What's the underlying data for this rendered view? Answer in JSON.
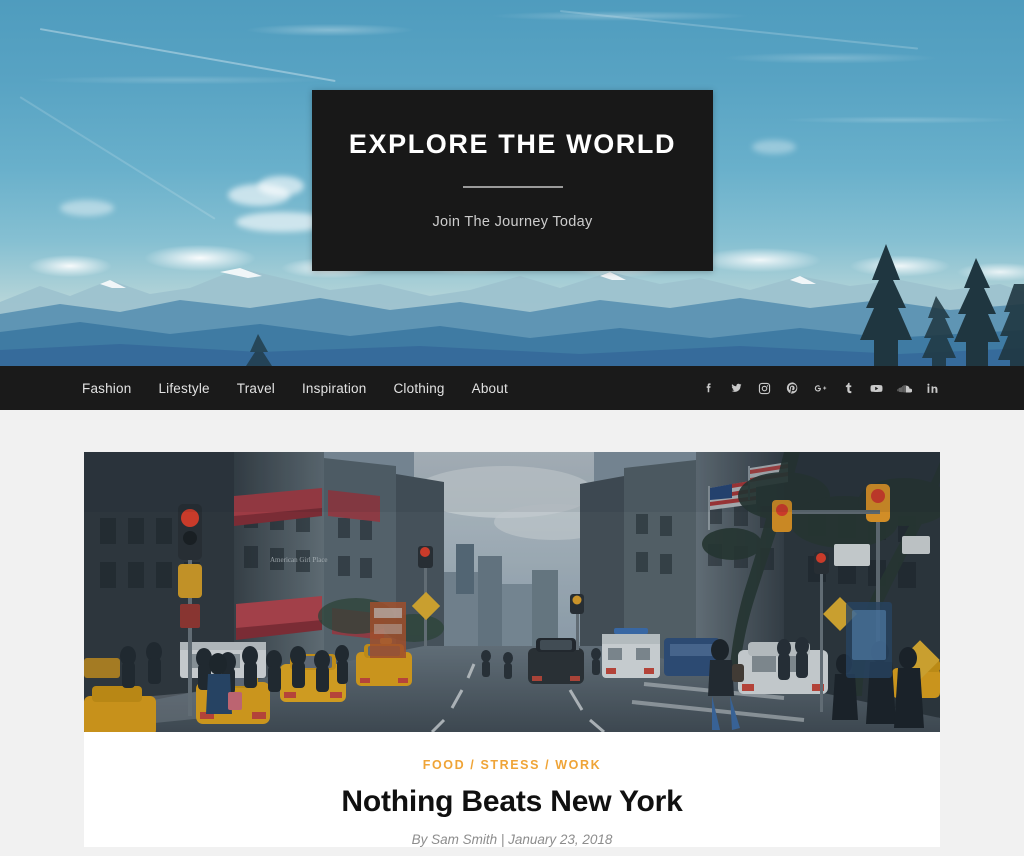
{
  "hero": {
    "title": "EXPLORE THE WORLD",
    "subtitle": "Join The Journey Today",
    "background_image": "mountain-landscape-blue-sky",
    "box_color": "#181818"
  },
  "nav": {
    "items": [
      {
        "label": "Fashion"
      },
      {
        "label": "Lifestyle"
      },
      {
        "label": "Travel"
      },
      {
        "label": "Inspiration"
      },
      {
        "label": "Clothing"
      },
      {
        "label": "About"
      }
    ],
    "socials": [
      {
        "name": "facebook-icon"
      },
      {
        "name": "twitter-icon"
      },
      {
        "name": "instagram-icon"
      },
      {
        "name": "pinterest-icon"
      },
      {
        "name": "google-plus-icon"
      },
      {
        "name": "tumblr-icon"
      },
      {
        "name": "youtube-icon"
      },
      {
        "name": "soundcloud-icon"
      },
      {
        "name": "linkedin-icon"
      }
    ],
    "background_color": "#1a1a1a"
  },
  "article": {
    "featured_image": "new-york-city-street-taxis",
    "categories_text": "FOOD / STRESS / WORK",
    "categories": [
      "FOOD",
      "STRESS",
      "WORK"
    ],
    "category_color": "#efa437",
    "title": "Nothing Beats New York",
    "author_prefix": "By",
    "author": "Sam Smith",
    "separator": "|",
    "date": "January 23, 2018",
    "byline": "By Sam Smith | January 23, 2018"
  },
  "page": {
    "background_color": "#f1f1f1",
    "card_background": "#ffffff"
  }
}
